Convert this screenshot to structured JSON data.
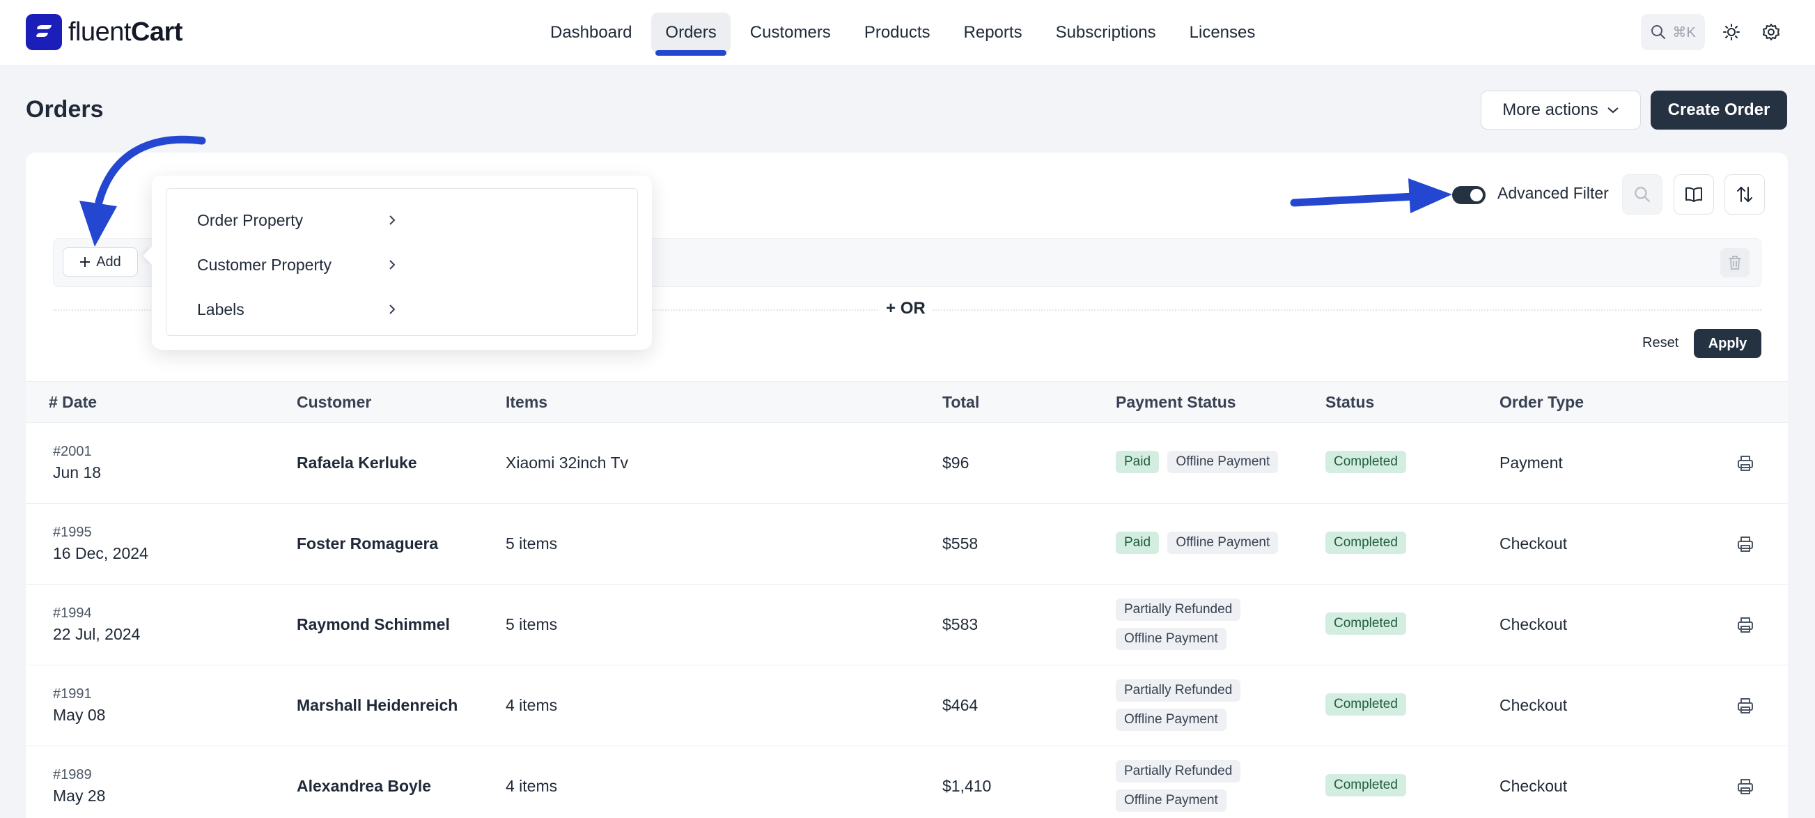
{
  "brand": {
    "name_light": "fluent",
    "name_bold": "Cart",
    "accent": "#1b1eb8"
  },
  "nav": {
    "items": [
      {
        "label": "Dashboard"
      },
      {
        "label": "Orders",
        "active": true
      },
      {
        "label": "Customers"
      },
      {
        "label": "Products"
      },
      {
        "label": "Reports"
      },
      {
        "label": "Subscriptions"
      },
      {
        "label": "Licenses"
      }
    ],
    "search_shortcut": "⌘K",
    "icons": [
      "search-icon",
      "sun-icon",
      "gear-icon"
    ]
  },
  "page": {
    "title": "Orders",
    "more_actions": "More actions",
    "create_order": "Create Order"
  },
  "filter": {
    "advanced_label": "Advanced Filter",
    "advanced_enabled": true,
    "add_label": "Add",
    "or_label": "OR",
    "reset": "Reset",
    "apply": "Apply",
    "menu": [
      {
        "label": "Order Property"
      },
      {
        "label": "Customer Property"
      },
      {
        "label": "Labels"
      }
    ]
  },
  "table": {
    "columns": {
      "date": "# Date",
      "customer": "Customer",
      "items": "Items",
      "total": "Total",
      "payment_status": "Payment Status",
      "status": "Status",
      "order_type": "Order Type"
    },
    "rows": [
      {
        "id": "#2001",
        "date": "Jun 18",
        "customer": "Rafaela Kerluke",
        "items": "Xiaomi 32inch Tv",
        "total": "$96",
        "payment": "Paid",
        "method": "Offline Payment",
        "status": "Completed",
        "type": "Payment"
      },
      {
        "id": "#1995",
        "date": "16 Dec, 2024",
        "customer": "Foster Romaguera",
        "items": "5 items",
        "total": "$558",
        "payment": "Paid",
        "method": "Offline Payment",
        "status": "Completed",
        "type": "Checkout"
      },
      {
        "id": "#1994",
        "date": "22 Jul, 2024",
        "customer": "Raymond Schimmel",
        "items": "5 items",
        "total": "$583",
        "payment": "Partially Refunded",
        "method": "Offline Payment",
        "status": "Completed",
        "type": "Checkout"
      },
      {
        "id": "#1991",
        "date": "May 08",
        "customer": "Marshall Heidenreich",
        "items": "4 items",
        "total": "$464",
        "payment": "Partially Refunded",
        "method": "Offline Payment",
        "status": "Completed",
        "type": "Checkout"
      },
      {
        "id": "#1989",
        "date": "May 28",
        "customer": "Alexandrea Boyle",
        "items": "4 items",
        "total": "$1,410",
        "payment": "Partially Refunded",
        "method": "Offline Payment",
        "status": "Completed",
        "type": "Checkout"
      }
    ]
  },
  "colors": {
    "dark_button": "#253241",
    "annotation_arrow": "#2447d2",
    "success_bg": "#d3ede1"
  }
}
